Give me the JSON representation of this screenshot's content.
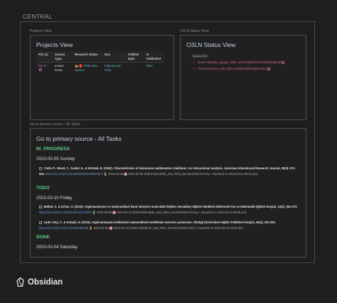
{
  "central_label": "CENTRAL",
  "projects_pane": {
    "label": "Projects View",
    "title": "Projects View",
    "columns": [
      "File (1)",
      "Source Type",
      "Research Status",
      "Due",
      "Publish Date",
      "Is Published"
    ],
    "rows": [
      {
        "file": "BBYR",
        "source_type": "master-thesis",
        "research_status": "✍️ 🔴 Write Intro Section",
        "due": "February 04, 2023",
        "publish_date": "-",
        "is_published": "false"
      }
    ]
  },
  "status_pane": {
    "label": "O3LN Status View",
    "title": "O3LN Status View",
    "badge": "#statusView",
    "items": [
      "O3LN newman_gough_2020_SystematicReviewsEducational",
      "O3LN lasseron_etal_2022_ChapterSharingReview"
    ]
  },
  "tasks_pane": {
    "label": "Go to primary source - All Tasks",
    "title": "Go to primary source - All Tasks",
    "in_progress_label": "IN_PROGRESS",
    "in_progress_date": "2023-03-05 Sunday",
    "task1": {
      "bold": "Cobb, P., Wood, T., Yackel, E., & McNeal, B. (1992). Characteristics of classroom mathematics traditions: An interactional analysis. American Educational Research Journal, 29(3), 573-604.",
      "doi": "https://doi.org/10.3102/00028312029003573",
      "meta": "⏳ 2023-03-05 📅 2023-03-05 (O3FN tekindede_etal_2022_DonelCizmlerinYuzey • Imported on 2023-03-24 05:31 pm)"
    },
    "todo_label": "TODO",
    "todo_date": "2023-03-10 Friday",
    "task2": {
      "bold": "Bülbül, A. & Urhan, S. (2016). Argümantasyon ve matematiksel kanıt süreçleri arasındaki ilişkiler. Necatibey Eğitim Fakültesi Elektronik Fen ve Matematik Eğitimi Dergisi, 10(2), 351-373.",
      "doi": "https://doi.org/10.17522/nefefmed.00287",
      "meta": "⏳ 2023-03-06 📅 2023-03-10 (O3FN tekindede_etal_2022_DonelCizmlerinYuzey • Imported on 2023-03-24 05:36 pm)"
    },
    "task3": {
      "bold": "Aydın Güç, F., & Kutaylı, H. (2022). Argümantasyon kalitesinin matematiksel modelleme sürecine yansıması. Uludağ Üniversitesi Eğitim Fakültesi Dergisi, 34(1), 222-262.",
      "doi": "https://doi.org/10.19171/uefad.850230",
      "meta": "⏳ 2023-03-06 📅 2023-03-10 (O3FN tekindede_etal_2022_DonelCizmlerinYuzey • Imported on 2023-03-24 05:36 pm)"
    },
    "done_label": "DONE",
    "done_date": "2023-03-04 Saturday"
  },
  "brand": "Obsidian",
  "colors": {
    "accent_green": "#5fd08d",
    "link_pink": "#d264a0",
    "heading_blue": "#c7d4e8"
  }
}
